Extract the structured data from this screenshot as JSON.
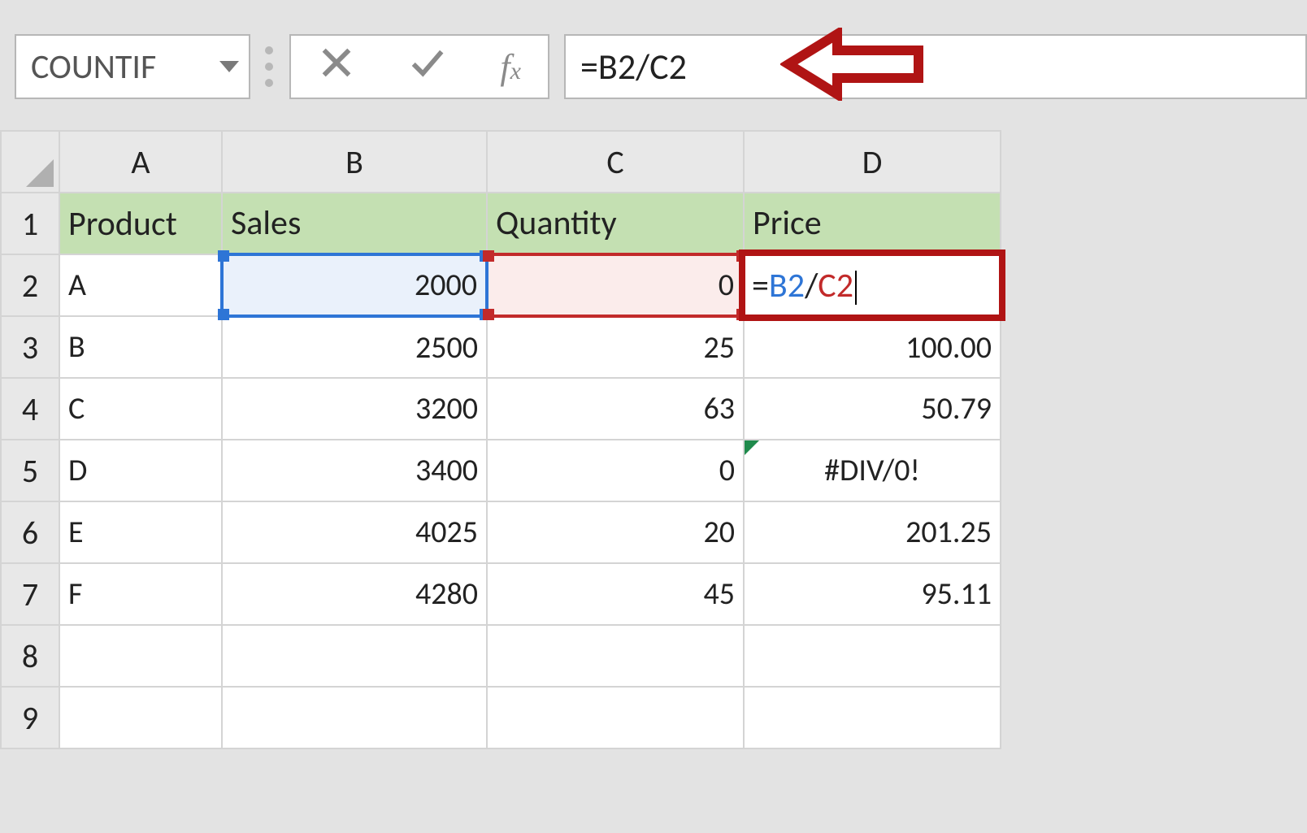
{
  "formula_bar": {
    "name_box": "COUNTIF",
    "formula": "=B2/C2"
  },
  "columns": {
    "A": "A",
    "B": "B",
    "C": "C",
    "D": "D"
  },
  "rows": [
    "1",
    "2",
    "3",
    "4",
    "5",
    "6",
    "7",
    "8",
    "9"
  ],
  "headers": {
    "A": "Product",
    "B": "Sales",
    "C": "Quantity",
    "D": "Price"
  },
  "edit_cell": {
    "prefix": "=",
    "ref1": "B2",
    "sep": "/",
    "ref2": "C2"
  },
  "data": {
    "r2": {
      "A": "A",
      "B": "2000",
      "C": "0",
      "D_formula": "=B2/C2"
    },
    "r3": {
      "A": "B",
      "B": "2500",
      "C": "25",
      "D": "100.00"
    },
    "r4": {
      "A": "C",
      "B": "3200",
      "C": "63",
      "D": "50.79"
    },
    "r5": {
      "A": "D",
      "B": "3400",
      "C": "0",
      "D": "#DIV/0!"
    },
    "r6": {
      "A": "E",
      "B": "4025",
      "C": "20",
      "D": "201.25"
    },
    "r7": {
      "A": "F",
      "B": "4280",
      "C": "45",
      "D": "95.11"
    }
  },
  "chart_data": {
    "type": "table",
    "columns": [
      "Product",
      "Sales",
      "Quantity",
      "Price"
    ],
    "rows": [
      [
        "A",
        2000,
        0,
        "=B2/C2"
      ],
      [
        "B",
        2500,
        25,
        100.0
      ],
      [
        "C",
        3200,
        63,
        50.79
      ],
      [
        "D",
        3400,
        0,
        "#DIV/0!"
      ],
      [
        "E",
        4025,
        20,
        201.25
      ],
      [
        "F",
        4280,
        45,
        95.11
      ]
    ]
  }
}
